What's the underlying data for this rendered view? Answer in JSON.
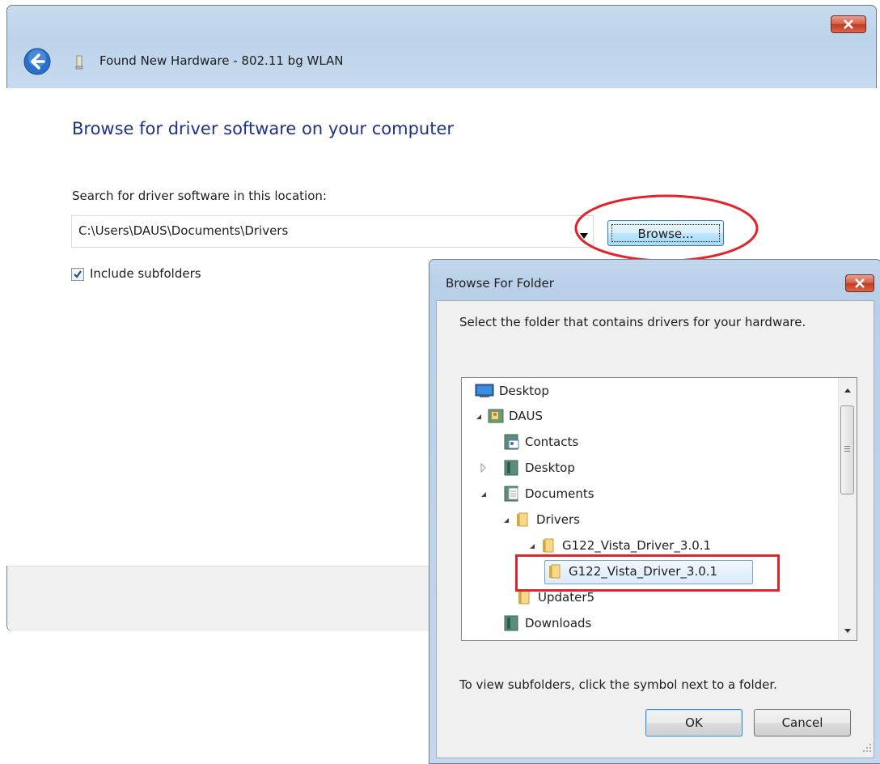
{
  "wizard": {
    "title": "Found New Hardware - 802.11 bg WLAN",
    "heading": "Browse for driver software on your computer",
    "search_label": "Search for driver software in this location:",
    "location_value": "C:\\Users\\DAUS\\Documents\\Drivers",
    "browse_label": "Browse...",
    "include_subfolders_label": "Include subfolders",
    "include_subfolders_checked": true
  },
  "folder_dialog": {
    "title": "Browse For Folder",
    "instruction": "Select the folder that contains drivers for your hardware.",
    "tree": [
      {
        "label": "Desktop",
        "icon": "desktop-icon",
        "expander": "none"
      },
      {
        "label": "DAUS",
        "icon": "user-folder-icon",
        "expander": "expanded"
      },
      {
        "label": "Contacts",
        "icon": "contacts-folder-icon",
        "expander": "none"
      },
      {
        "label": "Desktop",
        "icon": "desktop-folder-icon",
        "expander": "collapsed"
      },
      {
        "label": "Documents",
        "icon": "documents-folder-icon",
        "expander": "expanded"
      },
      {
        "label": "Drivers",
        "icon": "folder-icon",
        "expander": "expanded"
      },
      {
        "label": "G122_Vista_Driver_3.0.1",
        "icon": "folder-icon",
        "expander": "expanded"
      },
      {
        "label": "G122_Vista_Driver_3.0.1",
        "icon": "folder-icon",
        "expander": "none",
        "selected": true
      },
      {
        "label": "Updater5",
        "icon": "folder-icon",
        "expander": "none"
      },
      {
        "label": "Downloads",
        "icon": "downloads-folder-icon",
        "expander": "none"
      }
    ],
    "hint": "To view subfolders, click the symbol next to a folder.",
    "ok_label": "OK",
    "cancel_label": "Cancel"
  },
  "colors": {
    "heading": "#1e3287",
    "annotation_red": "#e2232a",
    "selection_border": "#7da2ce"
  }
}
